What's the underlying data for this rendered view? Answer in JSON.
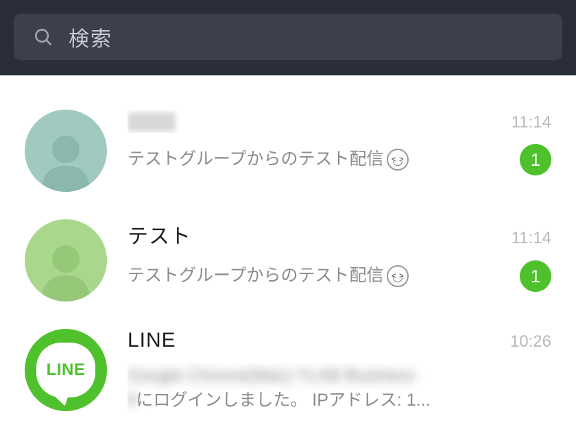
{
  "search": {
    "placeholder": "検索"
  },
  "chats": [
    {
      "title": "",
      "title_blurred": true,
      "time": "11:14",
      "preview": "テストグループからのテスト配信",
      "has_emoji": true,
      "unread": "1",
      "avatar_color": "teal"
    },
    {
      "title": "テスト",
      "title_blurred": false,
      "time": "11:14",
      "preview": "テストグループからのテスト配信",
      "has_emoji": true,
      "unread": "1",
      "avatar_color": "green"
    },
    {
      "title": "LINE",
      "title_blurred": false,
      "time": "10:26",
      "preview_line1_blurred": true,
      "preview_line2_prefix_blurred": true,
      "preview_line2_suffix": "にログインしました。 IPアドレス: 1...",
      "avatar_kind": "line_logo",
      "line_logo_text": "LINE"
    }
  ],
  "colors": {
    "accent": "#4ec12d",
    "header_bg": "#2a2d3a"
  }
}
